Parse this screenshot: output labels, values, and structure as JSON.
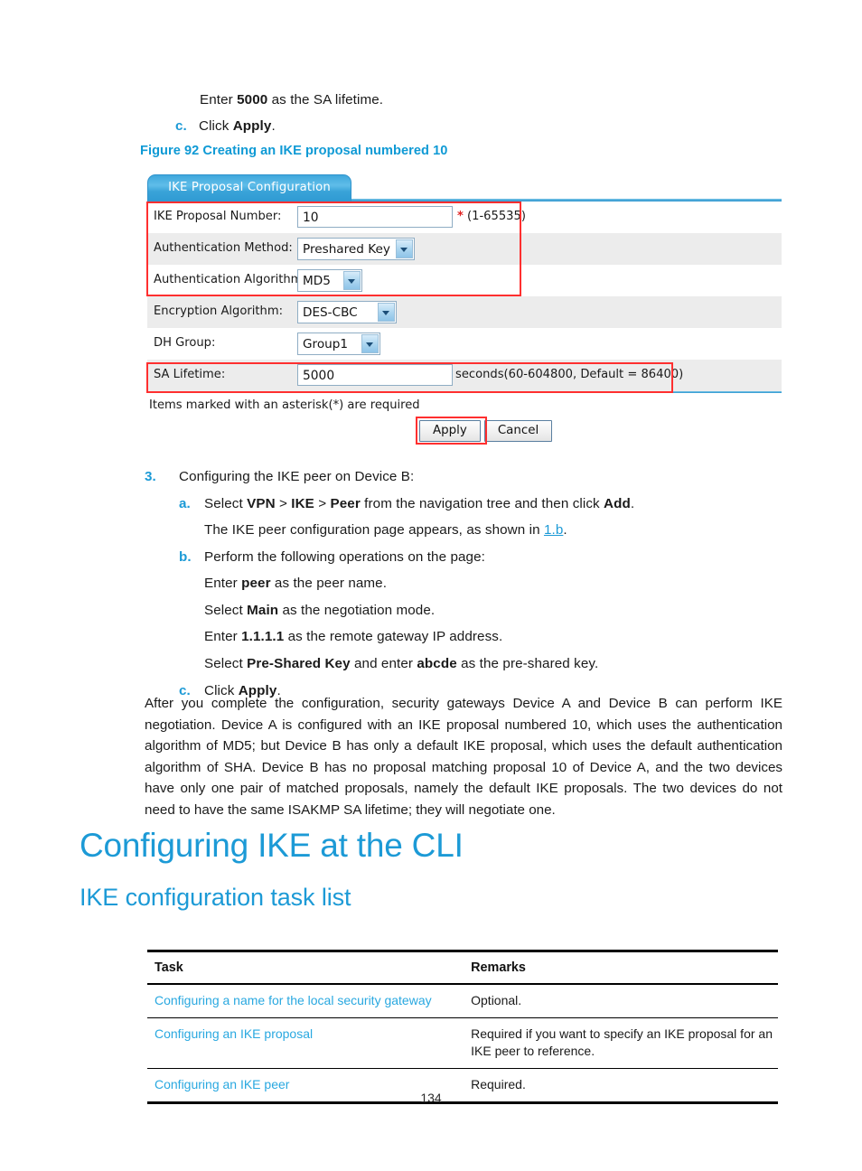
{
  "page": {
    "number": "134"
  },
  "top_steps": {
    "enter_lifetime": {
      "prefix": "Enter ",
      "bold": "5000",
      "suffix": " as the SA lifetime."
    },
    "step_c": {
      "marker": "c.",
      "prefix": "Click ",
      "bold": "Apply",
      "suffix": "."
    }
  },
  "figure": {
    "caption": "Figure 92 Creating an IKE proposal numbered 10",
    "tab_label": "IKE Proposal Configuration",
    "rows": [
      {
        "label": "IKE Proposal Number:",
        "type": "input",
        "value": "10",
        "hint_star": "*",
        "hint": " (1-65535)"
      },
      {
        "label": "Authentication Method:",
        "type": "select",
        "value": "Preshared Key"
      },
      {
        "label": "Authentication Algorithm:",
        "type": "select",
        "value": "MD5"
      },
      {
        "label": "Encryption Algorithm:",
        "type": "select",
        "value": "DES-CBC"
      },
      {
        "label": "DH Group:",
        "type": "select",
        "value": "Group1"
      },
      {
        "label": "SA Lifetime:",
        "type": "input",
        "value": "5000",
        "hint": "seconds(60-604800, Default = 86400)"
      }
    ],
    "note": "Items marked with an asterisk(*) are required",
    "apply_label": "Apply",
    "cancel_label": "Cancel",
    "accent_color": "#2e96cf",
    "highlight_color": "#ff2f2f",
    "row_gray": "#ececec"
  },
  "step3": {
    "marker": "3.",
    "title": "Configuring the IKE peer on Device B:",
    "a": {
      "marker": "a.",
      "t1": "Select ",
      "b1": "VPN",
      "t2": " > ",
      "b2": "IKE",
      "t3": " > ",
      "b3": "Peer",
      "t4": " from the navigation tree and then click ",
      "b4": "Add",
      "t5": "."
    },
    "a_note": {
      "t1": "The IKE peer configuration page appears, as shown in ",
      "link": "1.b",
      "t2": "."
    },
    "b": {
      "marker": "b.",
      "text": "Perform the following operations on the page:"
    },
    "b_items": [
      {
        "t1": "Enter ",
        "b1": "peer",
        "t2": " as the peer name."
      },
      {
        "t1": "Select ",
        "b1": "Main",
        "t2": " as the negotiation mode."
      },
      {
        "t1": "Enter ",
        "b1": "1.1.1.1",
        "t2": " as the remote gateway IP address."
      },
      {
        "t1": "Select ",
        "b1": "Pre-Shared Key",
        "t2": " and enter ",
        "b2": "abcde",
        "t3": " as the pre-shared key."
      }
    ],
    "c": {
      "marker": "c.",
      "t1": "Click ",
      "b1": "Apply",
      "t2": "."
    }
  },
  "paragraph": "After you complete the configuration, security gateways Device A and Device B can perform IKE negotiation. Device A is configured with an IKE proposal numbered 10, which uses the authentication algorithm of MD5; but Device B has only a default IKE proposal, which uses the default authentication algorithm of SHA. Device B has no proposal matching proposal 10 of Device A, and the two devices have only one pair of matched proposals, namely the default IKE proposals. The two devices do not need to have the same ISAKMP SA lifetime; they will negotiate one.",
  "headings": {
    "h1": "Configuring IKE at the CLI",
    "h2": "IKE configuration task list"
  },
  "task_table": {
    "headers": [
      "Task",
      "Remarks"
    ],
    "rows": [
      {
        "task": "Configuring a name for the local security gateway",
        "remarks": "Optional."
      },
      {
        "task": "Configuring an IKE proposal",
        "remarks": "Required if you want to specify an IKE proposal for an IKE peer to reference."
      },
      {
        "task": "Configuring an IKE peer",
        "remarks": "Required."
      }
    ]
  }
}
